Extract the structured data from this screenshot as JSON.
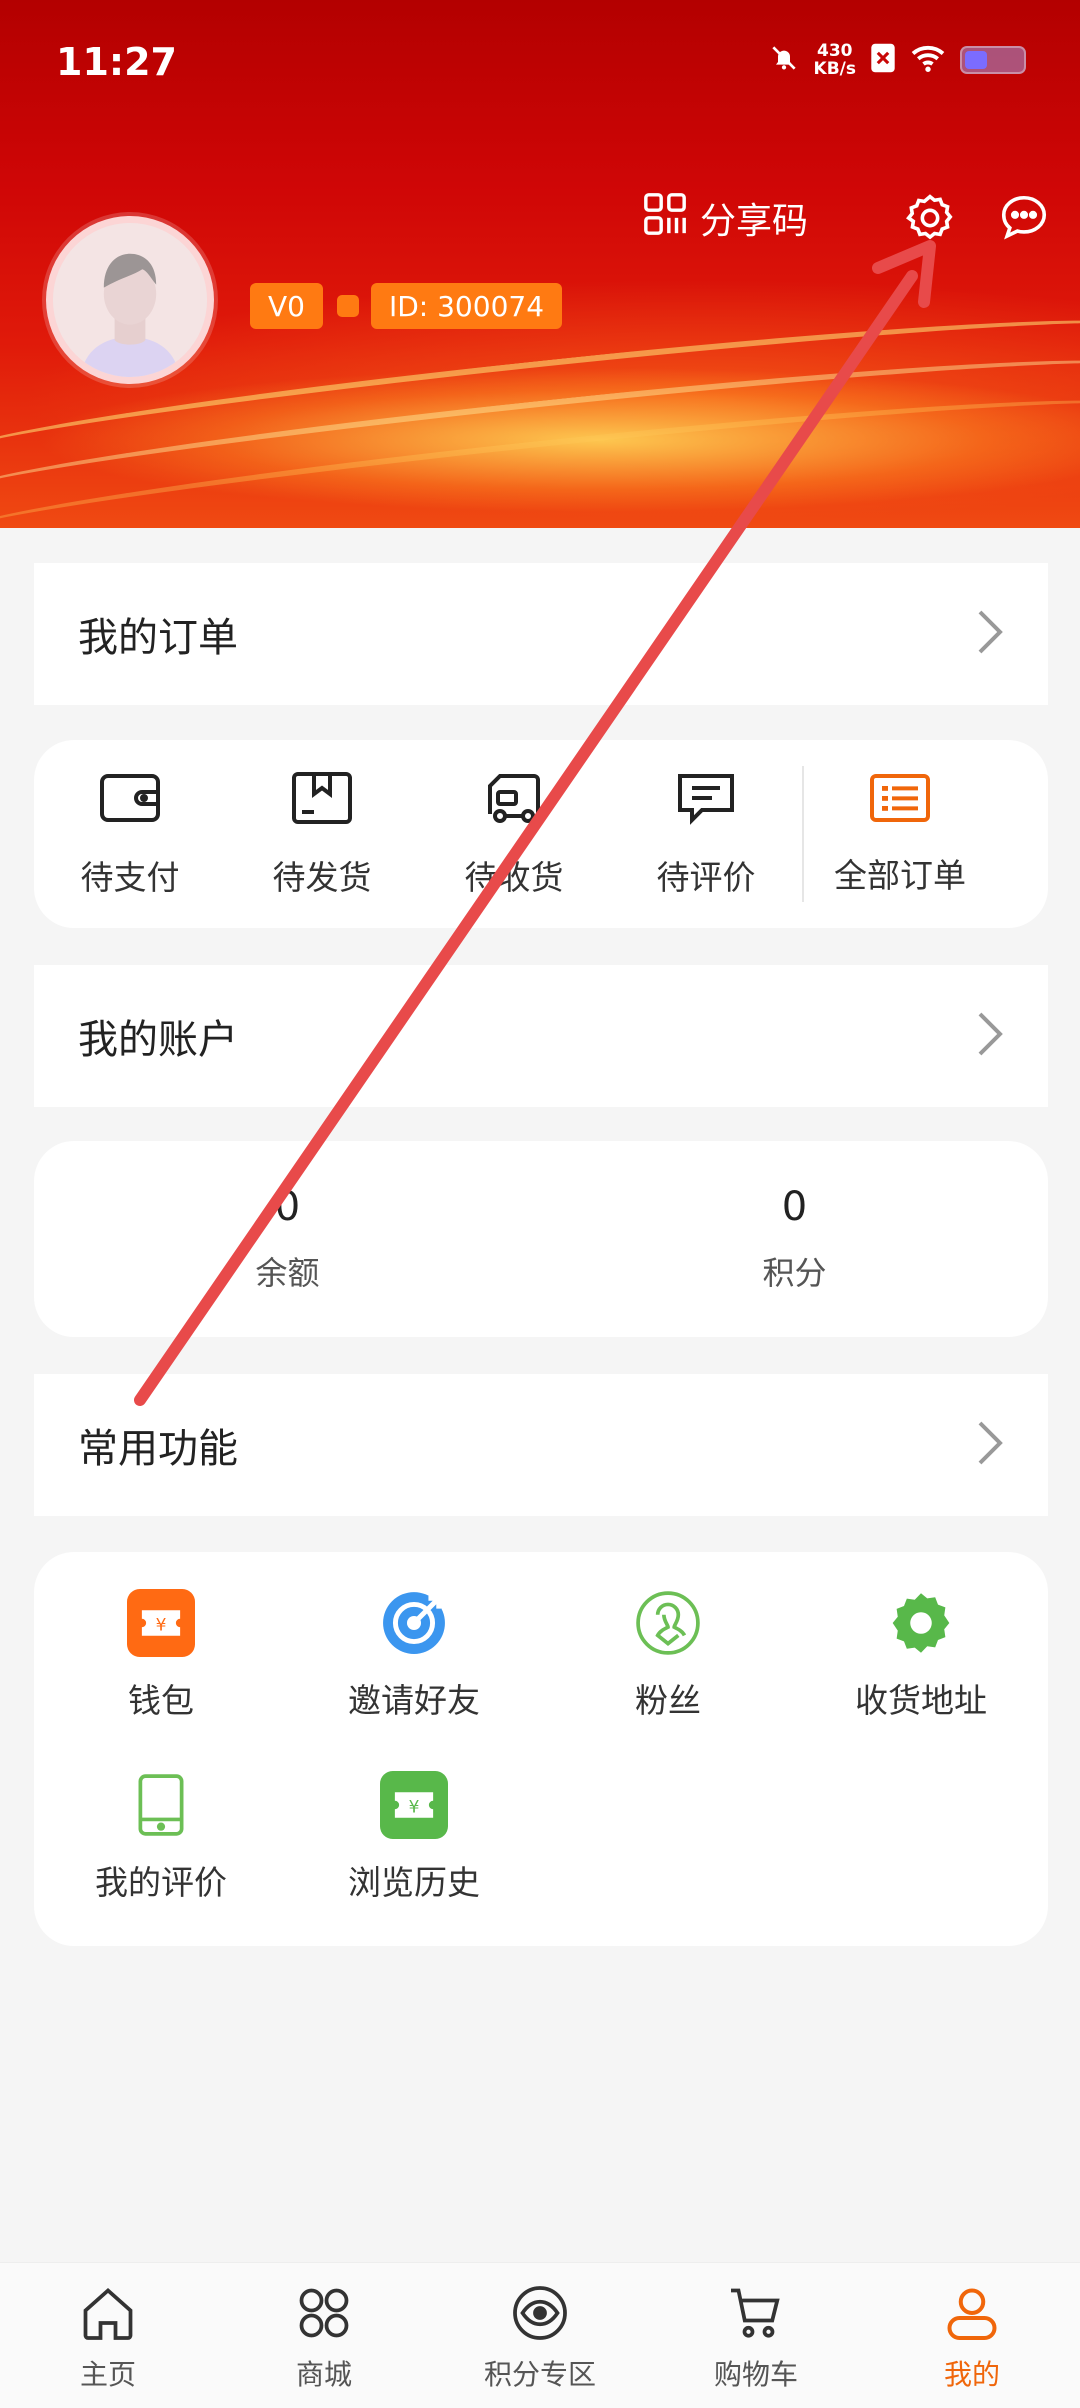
{
  "status_bar": {
    "time": "11:27",
    "net_speed_value": "430",
    "net_speed_unit": "KB/s"
  },
  "header": {
    "share_code_label": "分享码",
    "level_badge": "V0",
    "user_id": "ID: 300074"
  },
  "orders_section": {
    "title": "我的订单",
    "items": [
      {
        "label": "待支付",
        "icon": "wallet-icon"
      },
      {
        "label": "待发货",
        "icon": "package-icon"
      },
      {
        "label": "待收货",
        "icon": "delivery-truck-icon"
      },
      {
        "label": "待评价",
        "icon": "comment-icon"
      },
      {
        "label": "全部订单",
        "icon": "order-list-icon"
      }
    ]
  },
  "account_section": {
    "title": "我的账户",
    "balance": {
      "value": "0",
      "label": "余额"
    },
    "points": {
      "value": "0",
      "label": "积分"
    }
  },
  "functions_section": {
    "title": "常用功能",
    "items": [
      {
        "label": "钱包",
        "icon": "wallet-ticket-icon",
        "color": "#ff6a13"
      },
      {
        "label": "邀请好友",
        "icon": "target-icon",
        "color": "#3b96ef"
      },
      {
        "label": "粉丝",
        "icon": "user-outline-icon",
        "color": "#6cbf55"
      },
      {
        "label": "收货地址",
        "icon": "gear-icon",
        "color": "#58b84a"
      },
      {
        "label": "我的评价",
        "icon": "tablet-icon",
        "color": "#6cbf55"
      },
      {
        "label": "浏览历史",
        "icon": "money-ticket-icon",
        "color": "#58b84a"
      }
    ]
  },
  "bottom_nav": {
    "items": [
      {
        "label": "主页",
        "icon": "home-icon"
      },
      {
        "label": "商城",
        "icon": "grid-icon"
      },
      {
        "label": "积分专区",
        "icon": "eye-icon"
      },
      {
        "label": "购物车",
        "icon": "cart-icon"
      },
      {
        "label": "我的",
        "icon": "person-icon",
        "active": true
      }
    ]
  },
  "colors": {
    "accent": "#f0660a",
    "header_red": "#c80606",
    "badge_orange": "#ff7a12",
    "arrow_red": "#e84a4a"
  }
}
